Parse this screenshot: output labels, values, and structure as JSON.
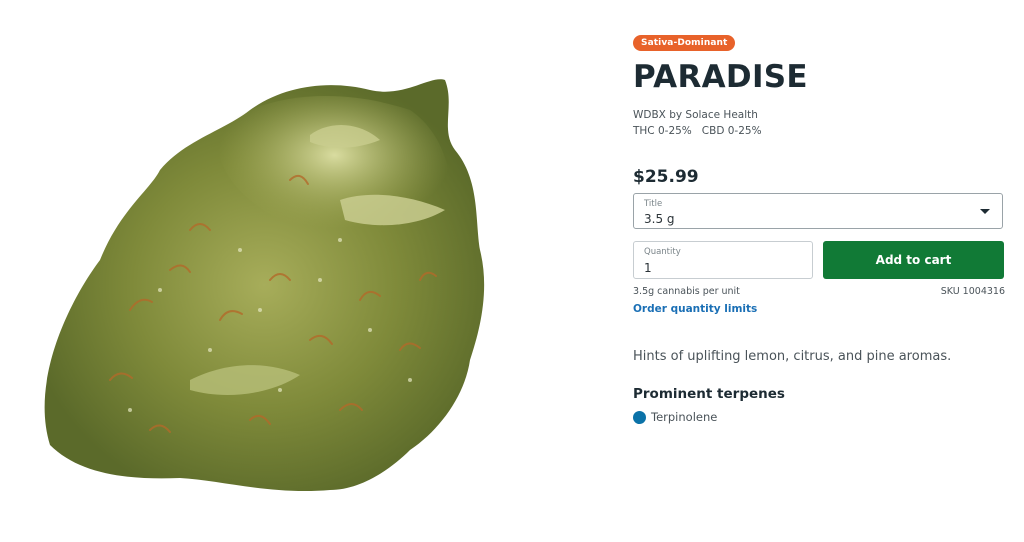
{
  "product": {
    "badge": "Sativa-Dominant",
    "name": "PARADISE",
    "brand": "WDBX by Solace Health",
    "thc": "THC 0-25%",
    "cbd": "CBD 0-25%",
    "price": "$25.99",
    "description": "Hints of uplifting lemon, citrus, and pine aromas."
  },
  "variant_select": {
    "label": "Title",
    "value": "3.5 g"
  },
  "quantity": {
    "label": "Quantity",
    "value": "1"
  },
  "cart": {
    "add_label": "Add to cart"
  },
  "meta": {
    "unit_info": "3.5g cannabis per unit",
    "sku": "SKU 1004316",
    "limits_link": "Order quantity limits"
  },
  "terpenes": {
    "heading": "Prominent terpenes",
    "items": [
      {
        "name": "Terpinolene",
        "color": "#0b72a8"
      }
    ]
  },
  "colors": {
    "badge": "#e8622a",
    "add_button": "#117a36",
    "link": "#1a6fb5"
  },
  "image": {
    "subject": "cannabis flower bud"
  }
}
